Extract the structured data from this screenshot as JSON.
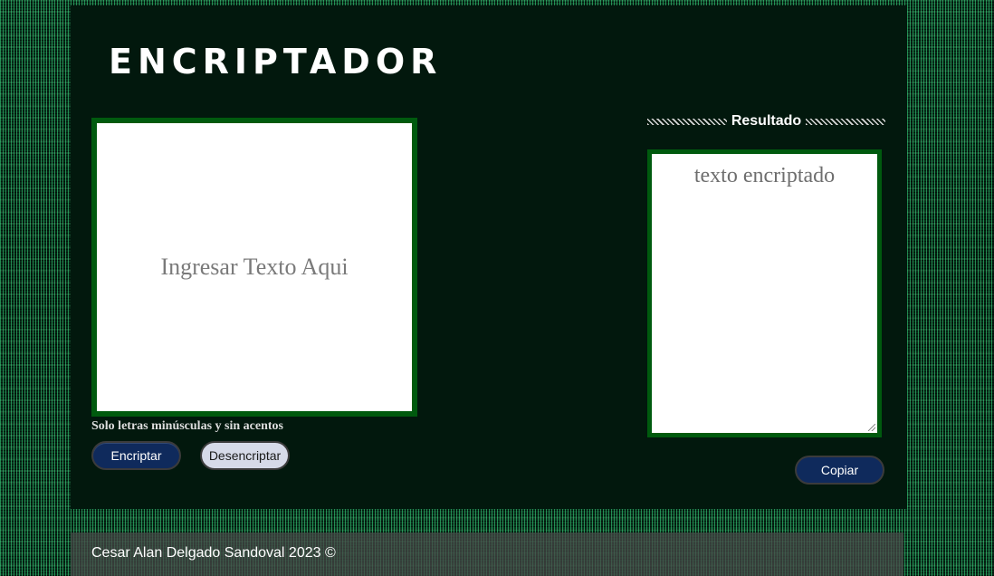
{
  "header": {
    "title": "ENCRIPTADOR"
  },
  "input": {
    "placeholder": "Ingresar Texto Aqui",
    "hint": "Solo letras minúsculas y sin acentos"
  },
  "buttons": {
    "encrypt_label": "Encriptar",
    "decrypt_label": "Desencriptar",
    "copy_label": "Copiar"
  },
  "result": {
    "heading": "Resultado",
    "placeholder": "texto encriptado"
  },
  "footer": {
    "text": "Cesar Alan Delgado Sandoval 2023 ©"
  },
  "colors": {
    "panel_background": "#02180d",
    "box_border": "#005a0e",
    "primary_button": "#0f2a5c",
    "secondary_button": "#d6dae8"
  }
}
